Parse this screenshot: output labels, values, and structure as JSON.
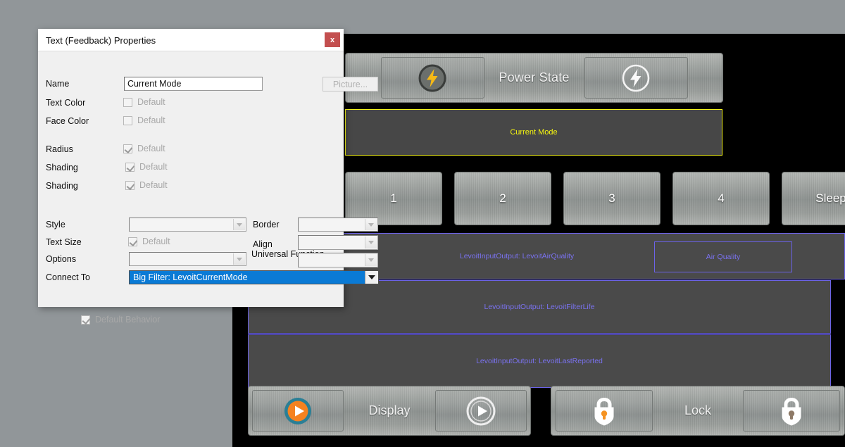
{
  "dialog": {
    "title": "Text (Feedback) Properties",
    "close_label": "x",
    "fields": {
      "name_label": "Name",
      "name_value": "Current Mode",
      "picture_button": "Picture...",
      "text_color_label": "Text Color",
      "text_color_default": "Default",
      "face_color_label": "Face Color",
      "face_color_default": "Default",
      "radius_label": "Radius",
      "radius_default": "Default",
      "shading1_label": "Shading",
      "shading1_default": "Default",
      "shading2_label": "Shading",
      "shading2_default": "Default",
      "style_label": "Style",
      "style_value": "",
      "border_label": "Border",
      "border_value": "",
      "text_size_label": "Text Size",
      "text_size_default": "Default",
      "align_label": "Align",
      "align_value": "",
      "options_label": "Options",
      "options_value": "",
      "universal_function_label": "Universal Function",
      "universal_function_value": "",
      "connect_to_label": "Connect To",
      "connect_to_value": "Big Filter: LevoitCurrentMode",
      "default_behavior_label": "Default Behavior"
    }
  },
  "panel": {
    "power": {
      "label": "Power State",
      "on_icon": "power-bolt-on-icon",
      "off_icon": "power-bolt-off-icon"
    },
    "current_mode": {
      "label": "Current Mode",
      "border_color": "#f2f21a",
      "text_color": "#f6f60f"
    },
    "modes": [
      {
        "label": "1"
      },
      {
        "label": "2"
      },
      {
        "label": "3"
      },
      {
        "label": "4"
      },
      {
        "label": "Sleep"
      }
    ],
    "data_rows": [
      {
        "label": "LevoitInputOutput: LevoitAirQuality",
        "inner_label": "Air Quality"
      },
      {
        "label": "LevoitInputOutput: LevoitFilterLife"
      },
      {
        "label": "LevoitInputOutput: LevoitLastReported"
      }
    ],
    "row_border_color": "#6c63e8",
    "row_text_color": "#7a72f0",
    "display": {
      "label": "Display",
      "on_icon": "play-circle-on-icon",
      "off_icon": "play-circle-off-icon"
    },
    "lock": {
      "label": "Lock",
      "on_icon": "lock-shield-on-icon",
      "off_icon": "lock-shield-off-icon"
    }
  },
  "colors": {
    "desktop": "#919699",
    "panel_bg": "#000000",
    "accent_blue": "#0a7ad5",
    "accent_orange": "#f59322",
    "accent_yellow": "#f6b916"
  }
}
